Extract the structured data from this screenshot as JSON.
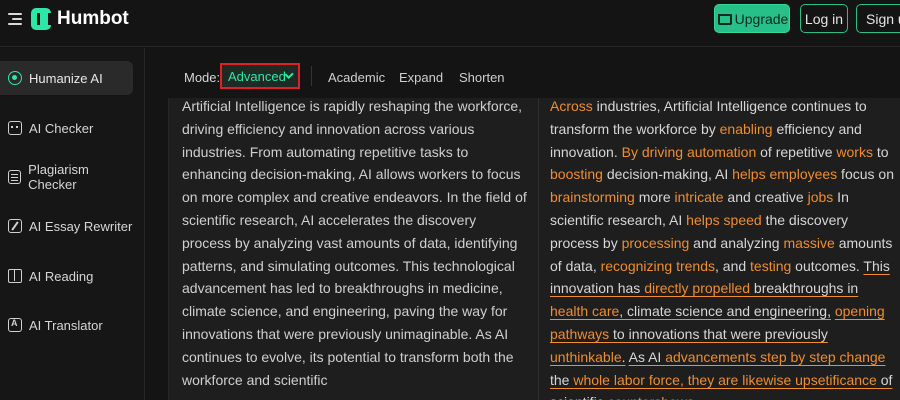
{
  "header": {
    "brand": "Humbot",
    "upgrade_label": "Upgrade",
    "login_label": "Log in",
    "signup_label": "Sign up"
  },
  "sidebar": {
    "items": [
      {
        "label": "Humanize AI",
        "icon": "brain-icon",
        "active": true
      },
      {
        "label": "AI Checker",
        "icon": "robot-icon"
      },
      {
        "label": "Plagiarism Checker",
        "icon": "document-icon"
      },
      {
        "label": "AI Essay Rewriter",
        "icon": "pen-icon"
      },
      {
        "label": "AI Reading",
        "icon": "book-icon"
      },
      {
        "label": "AI Translator",
        "icon": "translate-icon"
      }
    ]
  },
  "toolbar": {
    "mode_label": "Mode:",
    "mode_value": "Advanced",
    "tabs": [
      "Academic",
      "Expand",
      "Shorten"
    ]
  },
  "input_text": "Artificial Intelligence is rapidly reshaping the workforce, driving efficiency and innovation across various industries. From automating repetitive tasks to enhancing decision-making, AI allows workers to focus on more complex and creative endeavors. In the field of scientific research, AI accelerates the discovery process by analyzing vast amounts of data, identifying patterns, and simulating outcomes. This technological advancement has led to breakthroughs in medicine, climate science, and engineering, paving the way for innovations that were previously unimaginable. As AI continues to evolve, its potential to transform both the workforce and scientific",
  "output_segments": [
    {
      "t": "Across",
      "s": "hl"
    },
    {
      "t": " industries, Artificial Intelligence continues to transform the workforce by ",
      "s": ""
    },
    {
      "t": "enabling",
      "s": "hl"
    },
    {
      "t": " efficiency and innovation. ",
      "s": ""
    },
    {
      "t": "By driving",
      "s": "hl"
    },
    {
      "t": " ",
      "s": ""
    },
    {
      "t": "automation",
      "s": "hl"
    },
    {
      "t": " of repetitive ",
      "s": ""
    },
    {
      "t": "works",
      "s": "hl"
    },
    {
      "t": " to ",
      "s": ""
    },
    {
      "t": "boosting",
      "s": "hl"
    },
    {
      "t": " decision-making, AI ",
      "s": ""
    },
    {
      "t": "helps employees",
      "s": "hl"
    },
    {
      "t": " focus on ",
      "s": ""
    },
    {
      "t": "brainstorming",
      "s": "hl"
    },
    {
      "t": " more ",
      "s": ""
    },
    {
      "t": "intricate",
      "s": "hl"
    },
    {
      "t": " and creative ",
      "s": ""
    },
    {
      "t": "jobs",
      "s": "hl"
    },
    {
      "t": " In scientific research, AI ",
      "s": ""
    },
    {
      "t": "helps speed",
      "s": "hl"
    },
    {
      "t": " the discovery process by ",
      "s": ""
    },
    {
      "t": "processing",
      "s": "hl"
    },
    {
      "t": " and analyzing ",
      "s": ""
    },
    {
      "t": "massive",
      "s": "hl"
    },
    {
      "t": " amounts of data, ",
      "s": ""
    },
    {
      "t": "recognizing trends",
      "s": "hl"
    },
    {
      "t": ", and ",
      "s": ""
    },
    {
      "t": "testing",
      "s": "hl"
    },
    {
      "t": " outcomes. ",
      "s": ""
    },
    {
      "t": "This innovation has ",
      "s": "u"
    },
    {
      "t": "directly propelled",
      "s": "ul"
    },
    {
      "t": " breakthroughs in ",
      "s": "u"
    },
    {
      "t": "health care",
      "s": "ul"
    },
    {
      "t": ", climate science and engineering,",
      "s": "u"
    },
    {
      "t": " ",
      "s": ""
    },
    {
      "t": "opening pathways",
      "s": "ul"
    },
    {
      "t": " to innovations that were previously ",
      "s": "u"
    },
    {
      "t": "unthinkable",
      "s": "ul"
    },
    {
      "t": ".",
      "s": "u"
    },
    {
      "t": " ",
      "s": ""
    },
    {
      "t": "As AI ",
      "s": "u"
    },
    {
      "t": "advancements step by step change",
      "s": "ul"
    },
    {
      "t": " the ",
      "s": "u"
    },
    {
      "t": "whole labor force, they are likewise upsetificance",
      "s": "ul"
    },
    {
      "t": " of scientific ",
      "s": "u"
    },
    {
      "t": "countershows.",
      "s": "ul"
    }
  ],
  "colors": {
    "accent": "#2ee6a8",
    "highlight": "#f08d2c",
    "selection_border": "#e01f26"
  }
}
